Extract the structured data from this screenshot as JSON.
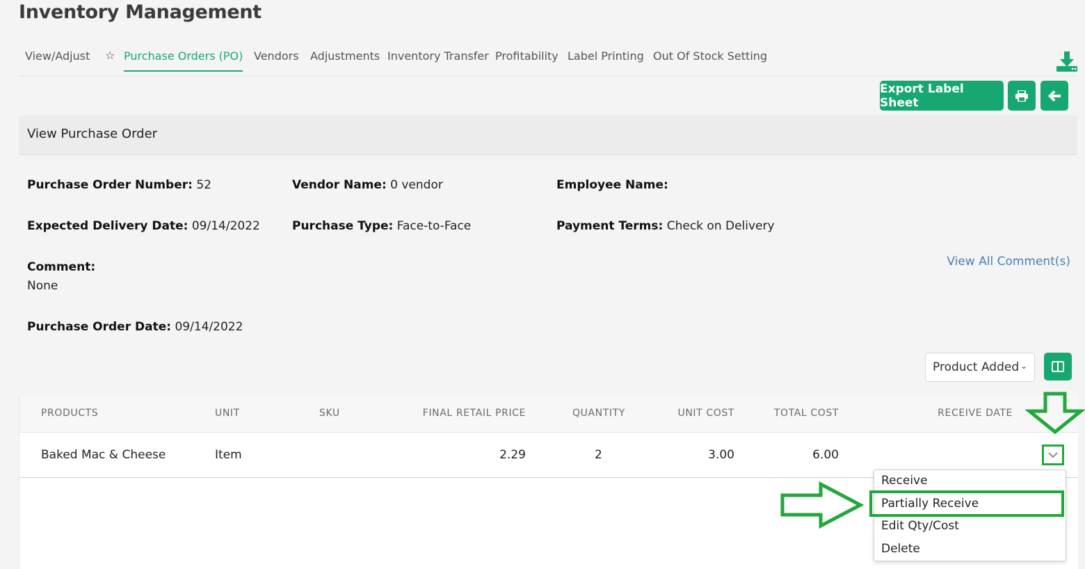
{
  "app": {
    "title": "Inventory Management"
  },
  "nav": {
    "tabs": [
      {
        "label": "View/Adjust"
      },
      {
        "label": "Purchase Orders (PO)",
        "active": true
      },
      {
        "label": "Vendors"
      },
      {
        "label": "Adjustments"
      },
      {
        "label": "Inventory Transfer"
      },
      {
        "label": "Profitability"
      },
      {
        "label": "Label Printing"
      },
      {
        "label": "Out Of Stock Setting"
      }
    ],
    "icons": {
      "favorite": "star-icon",
      "download": "download-icon"
    }
  },
  "toolbar": {
    "export_label": "Export Label Sheet",
    "print_icon": "print-icon",
    "back_icon": "arrow-left-icon"
  },
  "card": {
    "title": "View Purchase Order"
  },
  "po": {
    "number_label": "Purchase Order Number:",
    "number_value": "52",
    "vendor_label": "Vendor Name:",
    "vendor_value": "0 vendor",
    "employee_label": "Employee Name:",
    "employee_value": "",
    "delivery_label": "Expected Delivery Date:",
    "delivery_value": "09/14/2022",
    "type_label": "Purchase Type:",
    "type_value": "Face-to-Face",
    "terms_label": "Payment Terms:",
    "terms_value": "Check on Delivery",
    "comment_label": "Comment:",
    "comment_value": "None",
    "view_comments": "View All Comment(s)",
    "date_label": "Purchase Order Date:",
    "date_value": "09/14/2022"
  },
  "filter": {
    "selected": "Product Added",
    "columns_icon": "columns-icon"
  },
  "table": {
    "headers": [
      "PRODUCTS",
      "UNIT",
      "SKU",
      "FINAL RETAIL PRICE",
      "QUANTITY",
      "UNIT COST",
      "TOTAL COST",
      "RECEIVE DATE"
    ],
    "rows": [
      {
        "product": "Baked Mac & Cheese",
        "unit": "Item",
        "sku": "",
        "price": "2.29",
        "quantity": "2",
        "unit_cost": "3.00",
        "total_cost": "6.00",
        "receive_date": ""
      }
    ]
  },
  "menu": {
    "items": [
      "Receive",
      "Partially Receive",
      "Edit Qty/Cost",
      "Delete"
    ],
    "highlighted": "Partially Receive"
  },
  "colors": {
    "accent": "#16a870",
    "annotation": "#22a83c",
    "link": "#4a7fb5"
  }
}
